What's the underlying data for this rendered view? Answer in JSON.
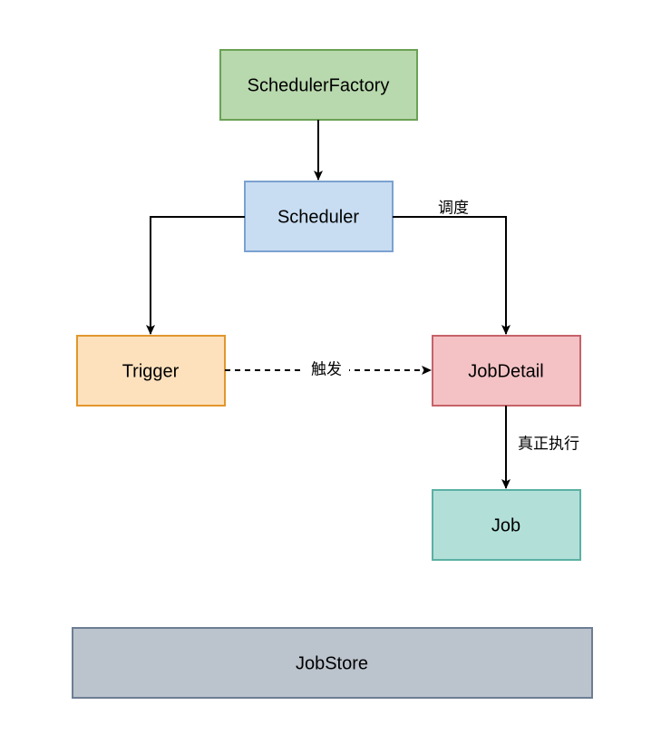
{
  "diagram": {
    "nodes": {
      "schedulerFactory": {
        "label": "SchedulerFactory",
        "fill": "#b8d8ad",
        "stroke": "#6aa154"
      },
      "scheduler": {
        "label": "Scheduler",
        "fill": "#c8ddf2",
        "stroke": "#7ca2d0"
      },
      "trigger": {
        "label": "Trigger",
        "fill": "#fde1bd",
        "stroke": "#e2962c"
      },
      "jobDetail": {
        "label": "JobDetail",
        "fill": "#f4c2c5",
        "stroke": "#c66269"
      },
      "job": {
        "label": "Job",
        "fill": "#b2e0d9",
        "stroke": "#5bb0a3"
      },
      "jobStore": {
        "label": "JobStore",
        "fill": "#bbc3cd",
        "stroke": "#6d7e93"
      }
    },
    "edges": {
      "schedule": {
        "label": "调度"
      },
      "trigger": {
        "label": "触发"
      },
      "execute": {
        "label": "真正执行"
      }
    }
  }
}
